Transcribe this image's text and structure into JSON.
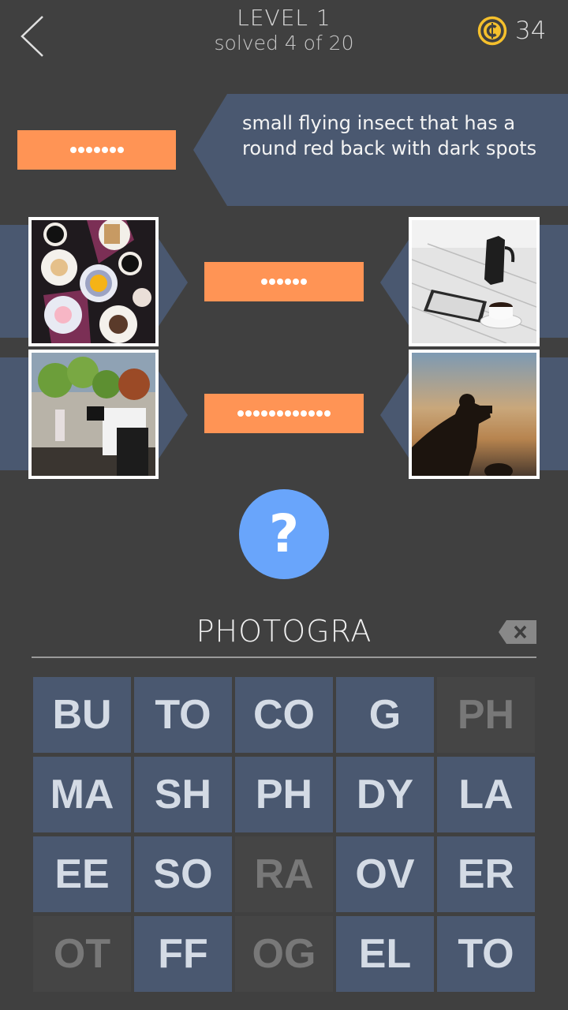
{
  "header": {
    "back_icon": "chevron-left-icon",
    "level_title": "LEVEL 1",
    "progress_text": "solved 4 of 20",
    "coin_icon": "coin-icon",
    "coins": "34"
  },
  "colors": {
    "background": "#404040",
    "band": "#4a5870",
    "answer": "#ff9455",
    "hint": "#69a5fb",
    "tile_text": "#d4dbe5",
    "tile_used_text": "#787878",
    "coin": "#f5c02c"
  },
  "clue": {
    "text": "small flying insect that has a round red back with dark spots",
    "answer_length": 7
  },
  "picture_pairs": [
    {
      "left_image": "coffee-and-pastries-photo",
      "right_image": "moka-pot-and-coffee-cup-photo",
      "answer_length": 6
    },
    {
      "left_image": "woman-with-camera-photo",
      "right_image": "photographer-silhouette-sunset-photo",
      "answer_length": 12
    }
  ],
  "hint": {
    "icon": "question-mark-icon",
    "label": "?"
  },
  "input": {
    "value": "PHOTOGRA",
    "backspace_icon": "backspace-icon"
  },
  "tiles": [
    {
      "label": "BU",
      "used": false
    },
    {
      "label": "TO",
      "used": false
    },
    {
      "label": "CO",
      "used": false
    },
    {
      "label": "G",
      "used": false
    },
    {
      "label": "PH",
      "used": true
    },
    {
      "label": "MA",
      "used": false
    },
    {
      "label": "SH",
      "used": false
    },
    {
      "label": "PH",
      "used": false
    },
    {
      "label": "DY",
      "used": false
    },
    {
      "label": "LA",
      "used": false
    },
    {
      "label": "EE",
      "used": false
    },
    {
      "label": "SO",
      "used": false
    },
    {
      "label": "RA",
      "used": true
    },
    {
      "label": "OV",
      "used": false
    },
    {
      "label": "ER",
      "used": false
    },
    {
      "label": "OT",
      "used": true
    },
    {
      "label": "FF",
      "used": false
    },
    {
      "label": "OG",
      "used": true
    },
    {
      "label": "EL",
      "used": false
    },
    {
      "label": "TO",
      "used": false
    }
  ]
}
